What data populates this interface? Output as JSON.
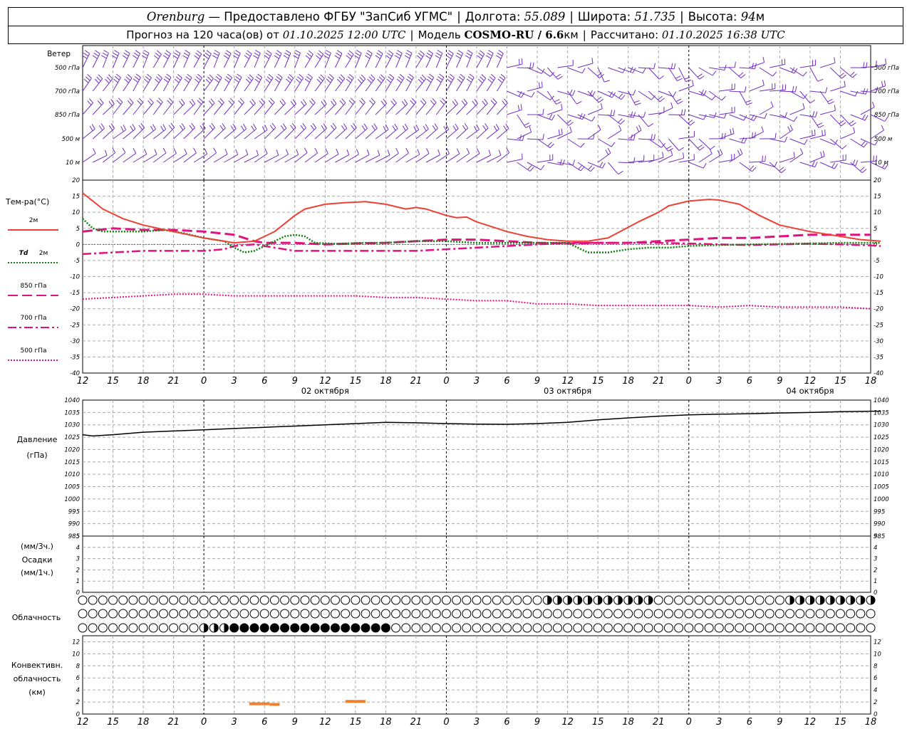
{
  "header": {
    "city": "Orenburg",
    "provider": "— Предоставлено ФГБУ \"ЗапСиб УГМС\"",
    "lon_label": "Долгота:",
    "lon": "55.089",
    "lat_label": "Широта:",
    "lat": "51.735",
    "alt_label": "Высота:",
    "alt": "94",
    "alt_unit": "м",
    "forecast_label": "Прогноз на 120 часа(ов) от",
    "forecast_time": "01.10.2025 12:00 UTC",
    "model_label": "Модель",
    "model": "COSMO-RU / 6.6",
    "model_unit": "км",
    "computed_label": "Рассчитано:",
    "computed_time": "01.10.2025 16:38 UTC"
  },
  "colors": {
    "t2m": "#ee4035",
    "td2m": "#108010",
    "t850": "#e0127f",
    "t700": "#e0127f",
    "t500": "#e0127f",
    "wind": "#7030c0",
    "pressure": "#000000",
    "conv": "#f08030",
    "grid": "#aaaaaa"
  },
  "chart_data": [
    {
      "type": "wind-barbs",
      "title": "Ветер",
      "levels": [
        "500 гПа",
        "700 гПа",
        "850 гПа",
        "500 м",
        "10 м"
      ]
    },
    {
      "type": "line",
      "ylabel": "Тем-ра(°С)",
      "ylim": [
        -40,
        20
      ],
      "yticks": [
        20,
        15,
        10,
        5,
        0,
        -5,
        -10,
        -15,
        -20,
        -25,
        -30,
        -35,
        -40
      ],
      "x_hours": [
        0,
        6,
        12,
        18,
        24,
        30,
        36,
        42,
        48,
        54,
        60,
        66,
        72,
        78
      ],
      "legend": [
        {
          "key": "t2m",
          "label": "2м",
          "style": "solid"
        },
        {
          "key": "td2m",
          "label": "Td",
          "sub": "2м",
          "style": "dotted"
        },
        {
          "key": "t850",
          "label": "850 гПа",
          "style": "dashed"
        },
        {
          "key": "t700",
          "label": "700 гПа",
          "style": "dashdot"
        },
        {
          "key": "t500",
          "label": "500 гПа",
          "style": "fine-dotted"
        }
      ],
      "series": {
        "t2m": [
          [
            0,
            16
          ],
          [
            2,
            11
          ],
          [
            4,
            8
          ],
          [
            6,
            6
          ],
          [
            9,
            4
          ],
          [
            12,
            2
          ],
          [
            14,
            1
          ],
          [
            15,
            0.5
          ],
          [
            17,
            1
          ],
          [
            19,
            4
          ],
          [
            21,
            9
          ],
          [
            22,
            11
          ],
          [
            24,
            12.5
          ],
          [
            26,
            13
          ],
          [
            28,
            13.3
          ],
          [
            30,
            12.5
          ],
          [
            32,
            11
          ],
          [
            33,
            11.5
          ],
          [
            34,
            11
          ],
          [
            35,
            10
          ],
          [
            36,
            9
          ],
          [
            37,
            8.3
          ],
          [
            38,
            8.5
          ],
          [
            39,
            7
          ],
          [
            40,
            6
          ],
          [
            42,
            4
          ],
          [
            44,
            2.5
          ],
          [
            46,
            1.5
          ],
          [
            48,
            1
          ],
          [
            50,
            1
          ],
          [
            52,
            2
          ],
          [
            55,
            7
          ],
          [
            57,
            10
          ],
          [
            58,
            12
          ],
          [
            60,
            13.5
          ],
          [
            62,
            14
          ],
          [
            63,
            13.8
          ],
          [
            65,
            12.5
          ],
          [
            67,
            9
          ],
          [
            69,
            6
          ],
          [
            72,
            4
          ],
          [
            75,
            2.5
          ],
          [
            77,
            1.5
          ],
          [
            79,
            1
          ]
        ],
        "td2m": [
          [
            0,
            8
          ],
          [
            1,
            5
          ],
          [
            2,
            4
          ],
          [
            6,
            4
          ],
          [
            8,
            4.5
          ],
          [
            10,
            3.5
          ],
          [
            12,
            2
          ],
          [
            14,
            1
          ],
          [
            15,
            -1
          ],
          [
            16,
            -2.5
          ],
          [
            17,
            -2
          ],
          [
            18,
            -0.5
          ],
          [
            19,
            1
          ],
          [
            20,
            2.5
          ],
          [
            21,
            3
          ],
          [
            22,
            2.5
          ],
          [
            23,
            0.5
          ],
          [
            25,
            0.2
          ],
          [
            28,
            0.5
          ],
          [
            30,
            0.5
          ],
          [
            33,
            1
          ],
          [
            36,
            1
          ],
          [
            39,
            0.5
          ],
          [
            42,
            0.5
          ],
          [
            45,
            0.5
          ],
          [
            48,
            0.5
          ],
          [
            49,
            -1
          ],
          [
            50,
            -2.5
          ],
          [
            52,
            -2.5
          ],
          [
            54,
            -1.5
          ],
          [
            56,
            -1
          ],
          [
            58,
            -1
          ],
          [
            60,
            -0.5
          ],
          [
            63,
            -0.2
          ],
          [
            66,
            0
          ],
          [
            70,
            0.2
          ],
          [
            75,
            0.5
          ],
          [
            78,
            0.5
          ],
          [
            79,
            0.5
          ]
        ],
        "t850": [
          [
            0,
            4
          ],
          [
            3,
            5
          ],
          [
            6,
            4.5
          ],
          [
            9,
            4.5
          ],
          [
            12,
            4
          ],
          [
            15,
            3
          ],
          [
            17,
            1
          ],
          [
            18,
            0.5
          ],
          [
            21,
            0.5
          ],
          [
            24,
            0
          ],
          [
            27,
            0.3
          ],
          [
            30,
            0.5
          ],
          [
            33,
            1
          ],
          [
            36,
            1.5
          ],
          [
            39,
            1.5
          ],
          [
            42,
            1
          ],
          [
            45,
            0.5
          ],
          [
            48,
            0.3
          ],
          [
            51,
            0.5
          ],
          [
            54,
            0.5
          ],
          [
            57,
            1
          ],
          [
            60,
            1.5
          ],
          [
            63,
            2
          ],
          [
            66,
            2
          ],
          [
            69,
            2.5
          ],
          [
            72,
            3
          ],
          [
            75,
            3
          ],
          [
            78,
            3
          ]
        ],
        "t700": [
          [
            0,
            -3
          ],
          [
            3,
            -2.5
          ],
          [
            6,
            -2
          ],
          [
            9,
            -2
          ],
          [
            12,
            -2
          ],
          [
            14,
            -1.5
          ],
          [
            15,
            -0.5
          ],
          [
            16,
            -0.2
          ],
          [
            17,
            0
          ],
          [
            18,
            -0.5
          ],
          [
            21,
            -2
          ],
          [
            24,
            -2
          ],
          [
            27,
            -2
          ],
          [
            30,
            -2
          ],
          [
            33,
            -2
          ],
          [
            36,
            -1.5
          ],
          [
            39,
            -1
          ],
          [
            42,
            -0.5
          ],
          [
            45,
            0
          ],
          [
            48,
            0.5
          ],
          [
            51,
            0.5
          ],
          [
            54,
            0.5
          ],
          [
            57,
            0.5
          ],
          [
            60,
            0.3
          ],
          [
            63,
            0
          ],
          [
            66,
            -0.2
          ],
          [
            69,
            0
          ],
          [
            72,
            0.2
          ],
          [
            75,
            0
          ],
          [
            78,
            -0.3
          ],
          [
            79,
            -0.5
          ]
        ],
        "t500": [
          [
            0,
            -17
          ],
          [
            3,
            -16.5
          ],
          [
            6,
            -16
          ],
          [
            9,
            -15.5
          ],
          [
            12,
            -15.5
          ],
          [
            15,
            -16
          ],
          [
            18,
            -16
          ],
          [
            21,
            -16
          ],
          [
            24,
            -16
          ],
          [
            27,
            -16
          ],
          [
            30,
            -16.5
          ],
          [
            33,
            -16.5
          ],
          [
            36,
            -17
          ],
          [
            39,
            -17.5
          ],
          [
            42,
            -17.5
          ],
          [
            45,
            -18.5
          ],
          [
            48,
            -18.5
          ],
          [
            51,
            -19
          ],
          [
            54,
            -19
          ],
          [
            57,
            -19
          ],
          [
            60,
            -19
          ],
          [
            63,
            -19.5
          ],
          [
            66,
            -19
          ],
          [
            69,
            -19.5
          ],
          [
            72,
            -19.5
          ],
          [
            75,
            -19.5
          ],
          [
            78,
            -20
          ]
        ]
      }
    },
    {
      "type": "line",
      "ylabel": "Давление",
      "yunit": "(гПа)",
      "ylim": [
        985,
        1040
      ],
      "yticks": [
        1040,
        1035,
        1030,
        1025,
        1020,
        1015,
        1010,
        1005,
        1000,
        995,
        990,
        985
      ],
      "series": {
        "pressure": [
          [
            0,
            1026
          ],
          [
            1,
            1025.5
          ],
          [
            3,
            1026
          ],
          [
            6,
            1027
          ],
          [
            9,
            1027.5
          ],
          [
            12,
            1028
          ],
          [
            15,
            1028.5
          ],
          [
            18,
            1029
          ],
          [
            21,
            1029.5
          ],
          [
            24,
            1030
          ],
          [
            27,
            1030.5
          ],
          [
            30,
            1031
          ],
          [
            33,
            1030.8
          ],
          [
            36,
            1030.5
          ],
          [
            39,
            1030.3
          ],
          [
            42,
            1030.2
          ],
          [
            45,
            1030.5
          ],
          [
            48,
            1031
          ],
          [
            51,
            1032
          ],
          [
            54,
            1032.8
          ],
          [
            57,
            1033.5
          ],
          [
            60,
            1034
          ],
          [
            63,
            1034.3
          ],
          [
            66,
            1034.5
          ],
          [
            69,
            1034.8
          ],
          [
            72,
            1035
          ],
          [
            75,
            1035.3
          ],
          [
            78,
            1035.5
          ],
          [
            79,
            1035.5
          ]
        ]
      }
    },
    {
      "type": "bar",
      "ylabel_top": "(мм/3ч.)",
      "ylabel": "Осадки",
      "ylabel_bottom": "(мм/1ч.)",
      "ylim": [
        0,
        5
      ],
      "yticks": [
        5,
        4,
        3,
        2,
        1,
        0
      ],
      "values": []
    },
    {
      "type": "cloud-cover",
      "label": "Облачность",
      "rows": 3
    },
    {
      "type": "bar",
      "ylabel_lines": [
        "Конвективн.",
        "облачность",
        "(км)"
      ],
      "ylim": [
        0,
        13
      ],
      "yticks": [
        12,
        10,
        8,
        6,
        4,
        2,
        0
      ],
      "segments": [
        {
          "x0": 16.5,
          "x1": 18.5,
          "y": 1.7
        },
        {
          "x0": 18.5,
          "x1": 19.5,
          "y": 1.6
        },
        {
          "x0": 26,
          "x1": 28,
          "y": 2.1
        }
      ]
    }
  ],
  "x_axis": {
    "labels": [
      "12",
      "15",
      "18",
      "21",
      "0",
      "3",
      "6",
      "9",
      "12",
      "15",
      "18",
      "21",
      "0",
      "3",
      "6",
      "9",
      "12",
      "15",
      "18",
      "21",
      "0",
      "3",
      "6",
      "9",
      "12",
      "15",
      "18"
    ],
    "dates": [
      {
        "label": "02 октября",
        "at_index": 8
      },
      {
        "label": "03 октября",
        "at_index": 16
      },
      {
        "label": "04 октября",
        "at_index": 24
      }
    ]
  }
}
